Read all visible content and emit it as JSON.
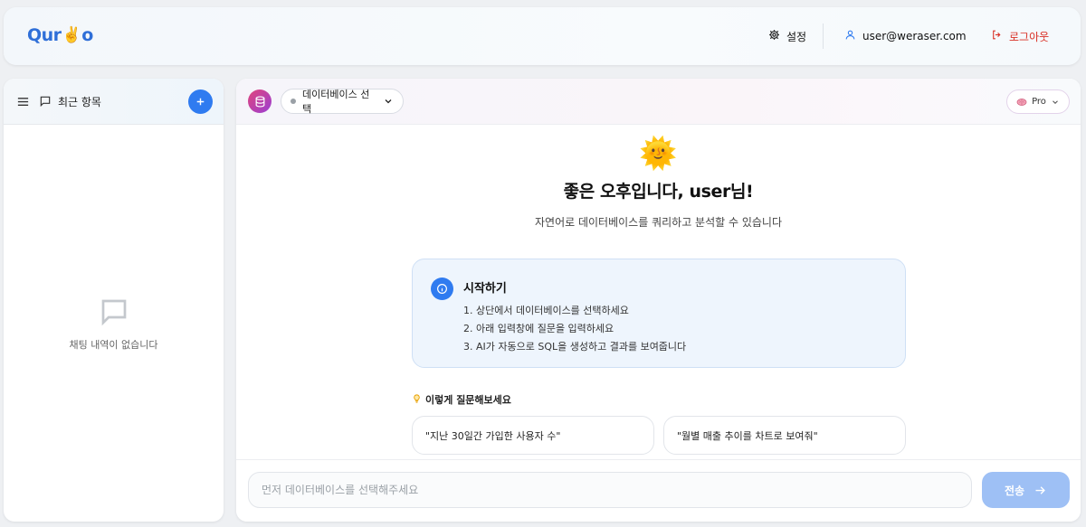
{
  "header": {
    "logo_text_left": "Qur",
    "logo_emoji": "✌️",
    "logo_text_right": "o",
    "settings_label": "설정",
    "user_email": "user@weraser.com",
    "logout_label": "로그아웃"
  },
  "sidebar": {
    "title": "최근 항목",
    "empty_text": "채팅 내역이 없습니다"
  },
  "toolbar": {
    "db_select_label": "데이터베이스 선택",
    "model_label": "Pro"
  },
  "welcome": {
    "emoji": "🌞",
    "greeting": "좋은 오후입니다, user님!",
    "subtitle": "자연어로 데이터베이스를 쿼리하고 분석할 수 있습니다"
  },
  "getting_started": {
    "title": "시작하기",
    "steps": [
      "1. 상단에서 데이터베이스를 선택하세요",
      "2. 아래 입력창에 질문을 입력하세요",
      "3. AI가 자동으로 SQL을 생성하고 결과를 보여줍니다"
    ]
  },
  "suggestions": {
    "label": "이렇게 질문해보세요",
    "items": [
      "\"지난 30일간 가입한 사용자 수\"",
      "\"월별 매출 추이를 차트로 보여줘\""
    ]
  },
  "composer": {
    "placeholder": "먼저 데이터베이스를 선택해주세요",
    "send_label": "전송"
  },
  "colors": {
    "accent": "#2f7bf0",
    "logout": "#d93025",
    "send_disabled": "#9ec0f5"
  }
}
